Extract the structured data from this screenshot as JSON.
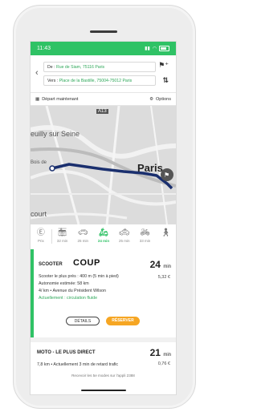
{
  "status": {
    "time": "11:43"
  },
  "route": {
    "from_prefix": "De : ",
    "from_value": "Rue de Siam, 75116 Paris",
    "to_prefix": "Vers : ",
    "to_value": "Place de la Bastille, 75004-75012 Paris"
  },
  "options": {
    "depart": "Départ maintenant",
    "options": "Options"
  },
  "map": {
    "label_seine": "euilly sur Seine",
    "label_paris": "Paris",
    "label_court": "court",
    "label_road": "A13",
    "label_bois": "Bois de"
  },
  "modes": [
    {
      "icon": "euro-icon",
      "glyph": "€",
      "label": "Prix"
    },
    {
      "icon": "metro-icon",
      "glyph": "▭",
      "label": "32 min"
    },
    {
      "icon": "car-icon",
      "glyph": "▬",
      "label": "25 min"
    },
    {
      "icon": "scooter-icon",
      "glyph": "♞",
      "label": "24 min",
      "active": true
    },
    {
      "icon": "taxi-icon",
      "glyph": "▬",
      "label": "25 min"
    },
    {
      "icon": "bike-icon",
      "glyph": "ổ",
      "label": "33 min"
    },
    {
      "icon": "walk-icon",
      "glyph": "↟",
      "label": ""
    }
  ],
  "card1": {
    "title": "SCOOTER",
    "logo": "COUP",
    "duration": "24",
    "duration_unit": "min",
    "price": "5,32 €",
    "lines": [
      "Scooter le plus près : 400 m (5 min à pied)",
      "Autonomie estimée: 58 km",
      "4/ km • Avenue du Président Wilson"
    ],
    "traffic": "Actuellement : circulation fluide",
    "details_label": "DÉTAILS",
    "reserve_label": "RÉSERVER"
  },
  "card2": {
    "title": "MOTO - LE PLUS DIRECT",
    "duration": "21",
    "duration_unit": "min",
    "price": "0,76 €",
    "line": "7,8 km • Actuellement 3 min de retard trafic"
  },
  "footer": "Recevoir les 5e modes sur l'appli 2388"
}
